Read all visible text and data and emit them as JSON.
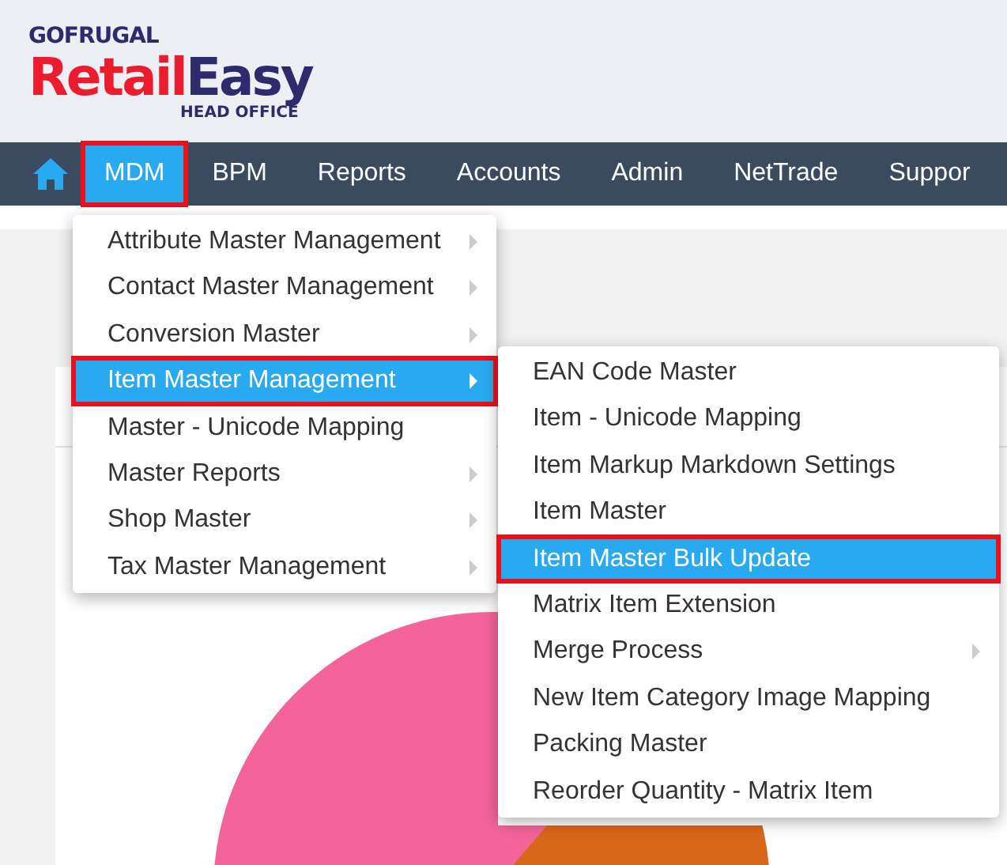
{
  "logo": {
    "brand": "GOFRUGAL",
    "name_part_1": "Retail",
    "name_part_2": "Easy",
    "edition": "HEAD OFFICE"
  },
  "nav": {
    "items": [
      {
        "label": "MDM",
        "selected": true,
        "outlined": true
      },
      {
        "label": "BPM",
        "selected": false,
        "outlined": false
      },
      {
        "label": "Reports",
        "selected": false,
        "outlined": false
      },
      {
        "label": "Accounts",
        "selected": false,
        "outlined": false
      },
      {
        "label": "Admin",
        "selected": false,
        "outlined": false
      },
      {
        "label": "NetTrade",
        "selected": false,
        "outlined": false
      },
      {
        "label": "Suppor",
        "selected": false,
        "outlined": false
      }
    ]
  },
  "menu": {
    "items": [
      {
        "label": "Attribute Master Management",
        "has_submenu": true,
        "selected": false,
        "outlined": false
      },
      {
        "label": "Contact Master Management",
        "has_submenu": true,
        "selected": false,
        "outlined": false
      },
      {
        "label": "Conversion Master",
        "has_submenu": true,
        "selected": false,
        "outlined": false
      },
      {
        "label": "Item Master Management",
        "has_submenu": true,
        "selected": true,
        "outlined": true
      },
      {
        "label": "Master - Unicode Mapping",
        "has_submenu": false,
        "selected": false,
        "outlined": false
      },
      {
        "label": "Master Reports",
        "has_submenu": true,
        "selected": false,
        "outlined": false
      },
      {
        "label": "Shop Master",
        "has_submenu": true,
        "selected": false,
        "outlined": false
      },
      {
        "label": "Tax Master Management",
        "has_submenu": true,
        "selected": false,
        "outlined": false
      }
    ]
  },
  "submenu": {
    "items": [
      {
        "label": "EAN Code Master",
        "has_submenu": false,
        "selected": false,
        "outlined": false
      },
      {
        "label": "Item - Unicode Mapping",
        "has_submenu": false,
        "selected": false,
        "outlined": false
      },
      {
        "label": "Item Markup Markdown Settings",
        "has_submenu": false,
        "selected": false,
        "outlined": false
      },
      {
        "label": "Item Master",
        "has_submenu": false,
        "selected": false,
        "outlined": false
      },
      {
        "label": "Item Master Bulk Update",
        "has_submenu": false,
        "selected": true,
        "outlined": true
      },
      {
        "label": "Matrix Item Extension",
        "has_submenu": false,
        "selected": false,
        "outlined": false
      },
      {
        "label": "Merge Process",
        "has_submenu": true,
        "selected": false,
        "outlined": false
      },
      {
        "label": "New Item Category Image Mapping",
        "has_submenu": false,
        "selected": false,
        "outlined": false
      },
      {
        "label": "Packing Master",
        "has_submenu": false,
        "selected": false,
        "outlined": false
      },
      {
        "label": "Reorder Quantity - Matrix Item",
        "has_submenu": false,
        "selected": false,
        "outlined": false
      }
    ]
  }
}
